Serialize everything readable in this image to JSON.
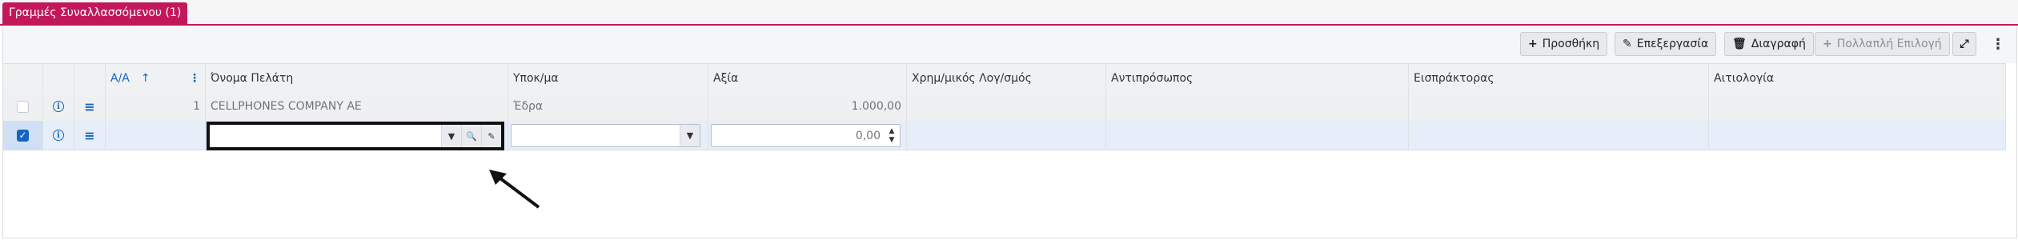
{
  "tab": {
    "label": "Γραμμές Συναλλασσόμενου (1)"
  },
  "toolbar": {
    "add_label": "Προσθήκη",
    "edit_label": "Επεξεργασία",
    "delete_label": "Διαγραφή",
    "multi_select_label": "Πολλαπλή Επιλογή",
    "add_icon": "plus-icon",
    "edit_icon": "pencil-icon",
    "delete_icon": "trash-icon",
    "multi_select_icon": "plus-icon",
    "expand_icon": "expand-icon",
    "more_icon": "kebab-icon"
  },
  "columns": {
    "aa": "Α/Α",
    "customer_name": "Όνομα Πελάτη",
    "branch": "Υποκ/μα",
    "value": "Αξία",
    "financial_account": "Χρημ/μικός Λογ/σμός",
    "representative": "Αντιπρόσωπος",
    "collector": "Εισπράκτορας",
    "reason": "Αιτιολογία"
  },
  "rows": [
    {
      "selected": false,
      "aa": "1",
      "customer_name": "CELLPHONES COMPANY AE",
      "branch": "Έδρα",
      "value": "1.000,00",
      "financial_account": "",
      "representative": "",
      "collector": "",
      "reason": ""
    },
    {
      "selected": true,
      "aa": "",
      "customer_name": "",
      "branch": "",
      "value": "0,00",
      "financial_account": "",
      "representative": "",
      "collector": "",
      "reason": ""
    }
  ],
  "colors": {
    "accent": "#c2185b",
    "primary": "#1565c0"
  }
}
